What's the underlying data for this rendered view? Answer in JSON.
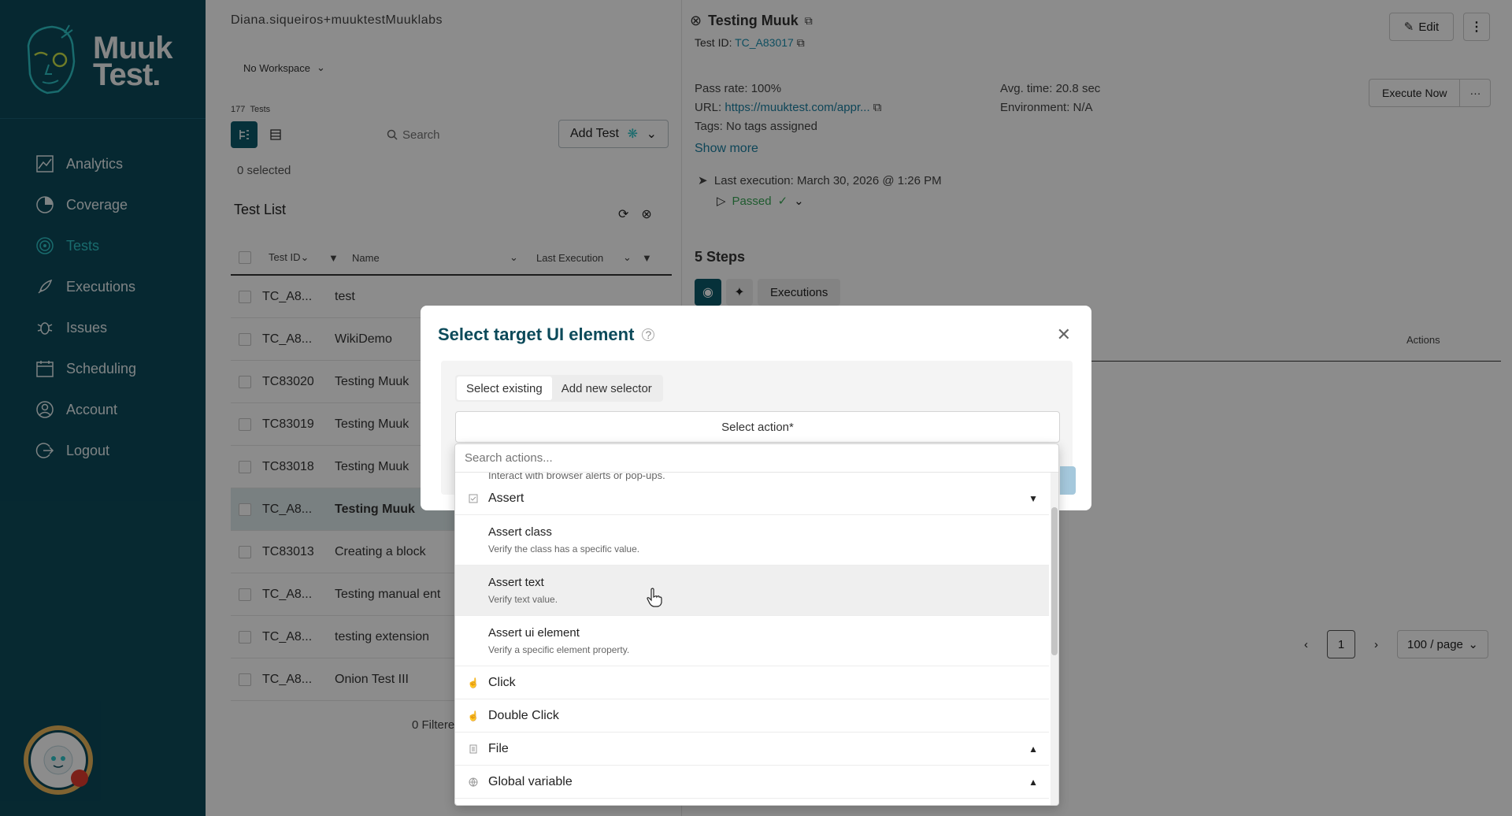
{
  "sidebar": {
    "brand_top": "Muuk",
    "brand_bottom": "Test.",
    "items": [
      {
        "label": "Analytics",
        "icon": "analytics-icon"
      },
      {
        "label": "Coverage",
        "icon": "coverage-icon"
      },
      {
        "label": "Tests",
        "icon": "tests-icon",
        "active": true
      },
      {
        "label": "Executions",
        "icon": "rocket-icon"
      },
      {
        "label": "Issues",
        "icon": "bug-icon"
      },
      {
        "label": "Scheduling",
        "icon": "calendar-icon"
      },
      {
        "label": "Account",
        "icon": "user-icon"
      },
      {
        "label": "Logout",
        "icon": "logout-icon"
      }
    ]
  },
  "left": {
    "user": "Diana.siqueiros+muuktestMuuklabs",
    "workspace": "No Workspace",
    "test_count": "177",
    "test_count_label": "Tests",
    "search_placeholder": "Search",
    "add_test": "Add Test",
    "selected": "0 selected",
    "list_title": "Test List",
    "headers": {
      "id": "Test ID",
      "name": "Name",
      "last_exec": "Last Execution"
    },
    "rows": [
      {
        "id": "TC_A8...",
        "name": "test"
      },
      {
        "id": "TC_A8...",
        "name": "WikiDemo"
      },
      {
        "id": "TC83020",
        "name": "Testing Muuk"
      },
      {
        "id": "TC83019",
        "name": "Testing Muuk"
      },
      {
        "id": "TC83018",
        "name": "Testing Muuk"
      },
      {
        "id": "TC_A8...",
        "name": "Testing Muuk",
        "selected": true
      },
      {
        "id": "TC83013",
        "name": "Creating a block"
      },
      {
        "id": "TC_A8...",
        "name": "Testing manual ent"
      },
      {
        "id": "TC_A8...",
        "name": "testing extension"
      },
      {
        "id": "TC_A8...",
        "name": "Onion Test III"
      }
    ],
    "filtered": "0 Filtere"
  },
  "right": {
    "title": "Testing Muuk",
    "test_id_label": "Test ID:",
    "test_id": "TC_A83017",
    "edit": "Edit",
    "pass_rate": "Pass rate: 100%",
    "url_label": "URL:",
    "url": "https://muuktest.com/appr...",
    "tags": "Tags: No tags assigned",
    "avg_time": "Avg. time: 20.8 sec",
    "environment": "Environment: N/A",
    "execute_now": "Execute Now",
    "show_more": "Show more",
    "last_execution": "Last execution:  March 30, 2026 @ 1:26 PM",
    "status": "Passed",
    "steps": "5 Steps",
    "executions_tab": "Executions",
    "actions_header": "Actions",
    "page": "1",
    "per_page": "100 / page"
  },
  "modal": {
    "title": "Select target UI element",
    "tab_existing": "Select existing",
    "tab_new": "Add new selector",
    "select_action": "Select action*",
    "search_placeholder": "Search actions...",
    "clipped_desc": "Interact with browser alerts or pop-ups.",
    "group_assert": "Assert",
    "options": [
      {
        "title": "Assert class",
        "desc": "Verify the class has a specific value."
      },
      {
        "title": "Assert text",
        "desc": "Verify text value."
      },
      {
        "title": "Assert ui element",
        "desc": "Verify a specific element property."
      }
    ],
    "click": "Click",
    "double_click": "Double Click",
    "file": "File",
    "global_variable": "Global variable"
  },
  "colors": {
    "brand": "#0c4a5a",
    "accent": "#2fc3c7",
    "link": "#1a8fb0",
    "passed": "#3aa757"
  }
}
